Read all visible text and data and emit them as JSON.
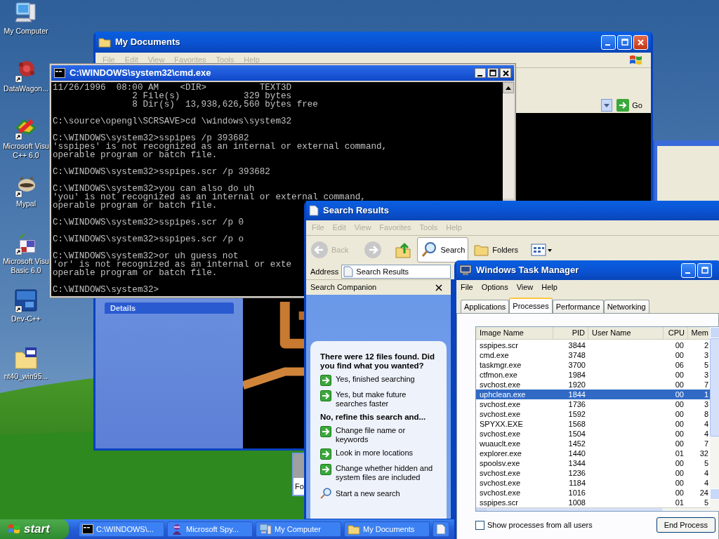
{
  "desktop_icons": [
    {
      "kind": "computer",
      "lines": [
        "My Computer"
      ]
    },
    {
      "kind": "flower",
      "lines": [
        "DataWagon..."
      ]
    },
    {
      "kind": "ribbon",
      "lines": [
        "Microsoft Visu",
        "C++ 6.0"
      ]
    },
    {
      "kind": "raccoon",
      "lines": [
        "Mypal"
      ]
    },
    {
      "kind": "plant",
      "lines": [
        "Microsoft Visu",
        "Basic 6.0"
      ]
    },
    {
      "kind": "dev",
      "lines": [
        "Dev-C++"
      ]
    },
    {
      "kind": "folder",
      "lines": [
        "nt40_win95..."
      ]
    }
  ],
  "my_documents": {
    "title": "My Documents",
    "menu": [
      "File",
      "Edit",
      "View",
      "Favorites",
      "Tools",
      "Help"
    ],
    "go": "Go",
    "details": "Details"
  },
  "cmd": {
    "title": "C:\\WINDOWS\\system32\\cmd.exe",
    "blocks": [
      [
        "11/26/1996  08:00 AM    <DIR>          TEXT3D",
        "               2 File(s)            329 bytes",
        "               8 Dir(s)  13,938,626,560 bytes free"
      ],
      [
        "C:\\source\\opengl\\SCRSAVE>cd \\windows\\system32"
      ],
      [
        "C:\\WINDOWS\\system32>sspipes /p 393682",
        "'sspipes' is not recognized as an internal or external command,",
        "operable program or batch file."
      ],
      [
        "C:\\WINDOWS\\system32>sspipes.scr /p 393682"
      ],
      [
        "C:\\WINDOWS\\system32>you can also do uh",
        "'you' is not recognized as an internal or external command,",
        "operable program or batch file."
      ],
      [
        "C:\\WINDOWS\\system32>sspipes.scr /p 0"
      ],
      [
        "C:\\WINDOWS\\system32>sspipes.scr /p o"
      ],
      [
        "C:\\WINDOWS\\system32>or uh guess not",
        "'or' is not recognized as an internal or exte",
        "operable program or batch file."
      ],
      [
        "C:\\WINDOWS\\system32>"
      ]
    ]
  },
  "fragment": "Fo",
  "search_results": {
    "title": "Search Results",
    "menu": [
      "File",
      "Edit",
      "View",
      "Favorites",
      "Tools",
      "Help"
    ],
    "back": {
      "label": "Back",
      "disabled": true
    },
    "search": {
      "label": "Search",
      "pressed": true
    },
    "folders": "Folders",
    "address_label": "Address",
    "address": "Search Results",
    "companion": "Search Companion",
    "question": "There were 12 files found. Did you find what you wanted?",
    "options": [
      "Yes, finished searching",
      "Yes, but make future searches faster"
    ],
    "refine": "No, refine this search and...",
    "refine_options": [
      "Change file name or keywords",
      "Look in more locations",
      "Change whether hidden and system files are included"
    ],
    "new_search": "Start a new search"
  },
  "task_manager": {
    "title": "Windows Task Manager",
    "menu": [
      "File",
      "Options",
      "View",
      "Help"
    ],
    "tabs": [
      {
        "label": "Applications",
        "selected": false
      },
      {
        "label": "Processes",
        "selected": true
      },
      {
        "label": "Performance",
        "selected": false
      },
      {
        "label": "Networking",
        "selected": false
      }
    ],
    "columns": [
      "Image Name",
      "PID",
      "User Name",
      "CPU",
      "Mem"
    ],
    "rows": [
      {
        "image": "sspipes.scr",
        "pid": "3844",
        "cpu": "00",
        "mem": "2",
        "selected": false
      },
      {
        "image": "cmd.exe",
        "pid": "3748",
        "cpu": "00",
        "mem": "3",
        "selected": false
      },
      {
        "image": "taskmgr.exe",
        "pid": "3700",
        "cpu": "06",
        "mem": "5",
        "selected": false
      },
      {
        "image": "ctfmon.exe",
        "pid": "1984",
        "cpu": "00",
        "mem": "3",
        "selected": false
      },
      {
        "image": "svchost.exe",
        "pid": "1920",
        "cpu": "00",
        "mem": "7",
        "selected": false
      },
      {
        "image": "uphclean.exe",
        "pid": "1844",
        "cpu": "00",
        "mem": "1",
        "selected": true
      },
      {
        "image": "svchost.exe",
        "pid": "1736",
        "cpu": "00",
        "mem": "3",
        "selected": false
      },
      {
        "image": "svchost.exe",
        "pid": "1592",
        "cpu": "00",
        "mem": "8",
        "selected": false
      },
      {
        "image": "SPYXX.EXE",
        "pid": "1568",
        "cpu": "00",
        "mem": "4",
        "selected": false
      },
      {
        "image": "svchost.exe",
        "pid": "1504",
        "cpu": "00",
        "mem": "4",
        "selected": false
      },
      {
        "image": "wuauclt.exe",
        "pid": "1452",
        "cpu": "00",
        "mem": "7",
        "selected": false
      },
      {
        "image": "explorer.exe",
        "pid": "1440",
        "cpu": "01",
        "mem": "32",
        "selected": false
      },
      {
        "image": "spoolsv.exe",
        "pid": "1344",
        "cpu": "00",
        "mem": "5",
        "selected": false
      },
      {
        "image": "svchost.exe",
        "pid": "1236",
        "cpu": "00",
        "mem": "4",
        "selected": false
      },
      {
        "image": "svchost.exe",
        "pid": "1184",
        "cpu": "00",
        "mem": "4",
        "selected": false
      },
      {
        "image": "svchost.exe",
        "pid": "1016",
        "cpu": "00",
        "mem": "24",
        "selected": false
      },
      {
        "image": "sspipes.scr",
        "pid": "1008",
        "cpu": "01",
        "mem": "5",
        "selected": false
      }
    ],
    "show_all": {
      "label": "Show processes from all users",
      "checked": false
    },
    "end_process": "End Process"
  },
  "taskbar": {
    "start": "start",
    "items": [
      {
        "kind": "console",
        "label": "C:\\WINDOWS\\..."
      },
      {
        "kind": "spy",
        "label": "Microsoft Spy..."
      },
      {
        "kind": "computer",
        "label": "My Computer"
      },
      {
        "kind": "folder",
        "label": "My Documents"
      },
      {
        "kind": "page"
      }
    ]
  }
}
